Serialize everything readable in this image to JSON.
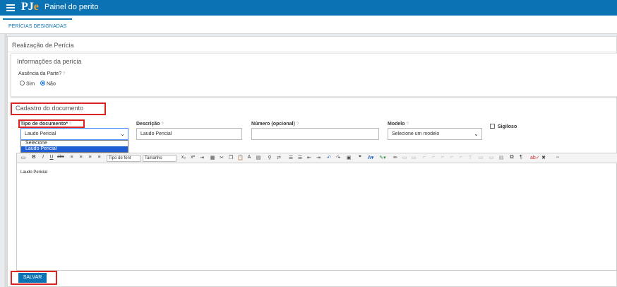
{
  "header": {
    "title": "Painel do perito",
    "logo_text": "PJ",
    "logo_accent": "e"
  },
  "tabs": [
    {
      "label": "PERÍCIAS DESIGNADAS"
    }
  ],
  "panel": {
    "title": "Realização de Perícia"
  },
  "info": {
    "title": "Informações da perícia",
    "absence_label": "Ausência da Parte?",
    "help_icon": "?",
    "options": [
      {
        "label": "Sim",
        "selected": false
      },
      {
        "label": "Não",
        "selected": true
      }
    ]
  },
  "cadastro": {
    "title": "Cadastro do documento",
    "tipo_label": "Tipo de documento*",
    "tipo_value": "Laudo Pericial",
    "tipo_options": [
      "Selecione",
      "Laudo Pericial"
    ],
    "descricao_label": "Descrição",
    "descricao_value": "Laudo Pericial",
    "numero_label": "Número (opcional)",
    "numero_value": "",
    "modelo_label": "Modelo",
    "modelo_value": "Selecione um modelo",
    "sigiloso_label": "Sigiloso"
  },
  "editor": {
    "font_select": "Tipo de font",
    "size_select": "Tamanho",
    "content": "Laudo Pericial"
  },
  "actions": {
    "save_label": "SALVAR"
  },
  "colors": {
    "header": "#0b73b3",
    "highlight": "#d22222",
    "selection": "#1e5dd3"
  }
}
